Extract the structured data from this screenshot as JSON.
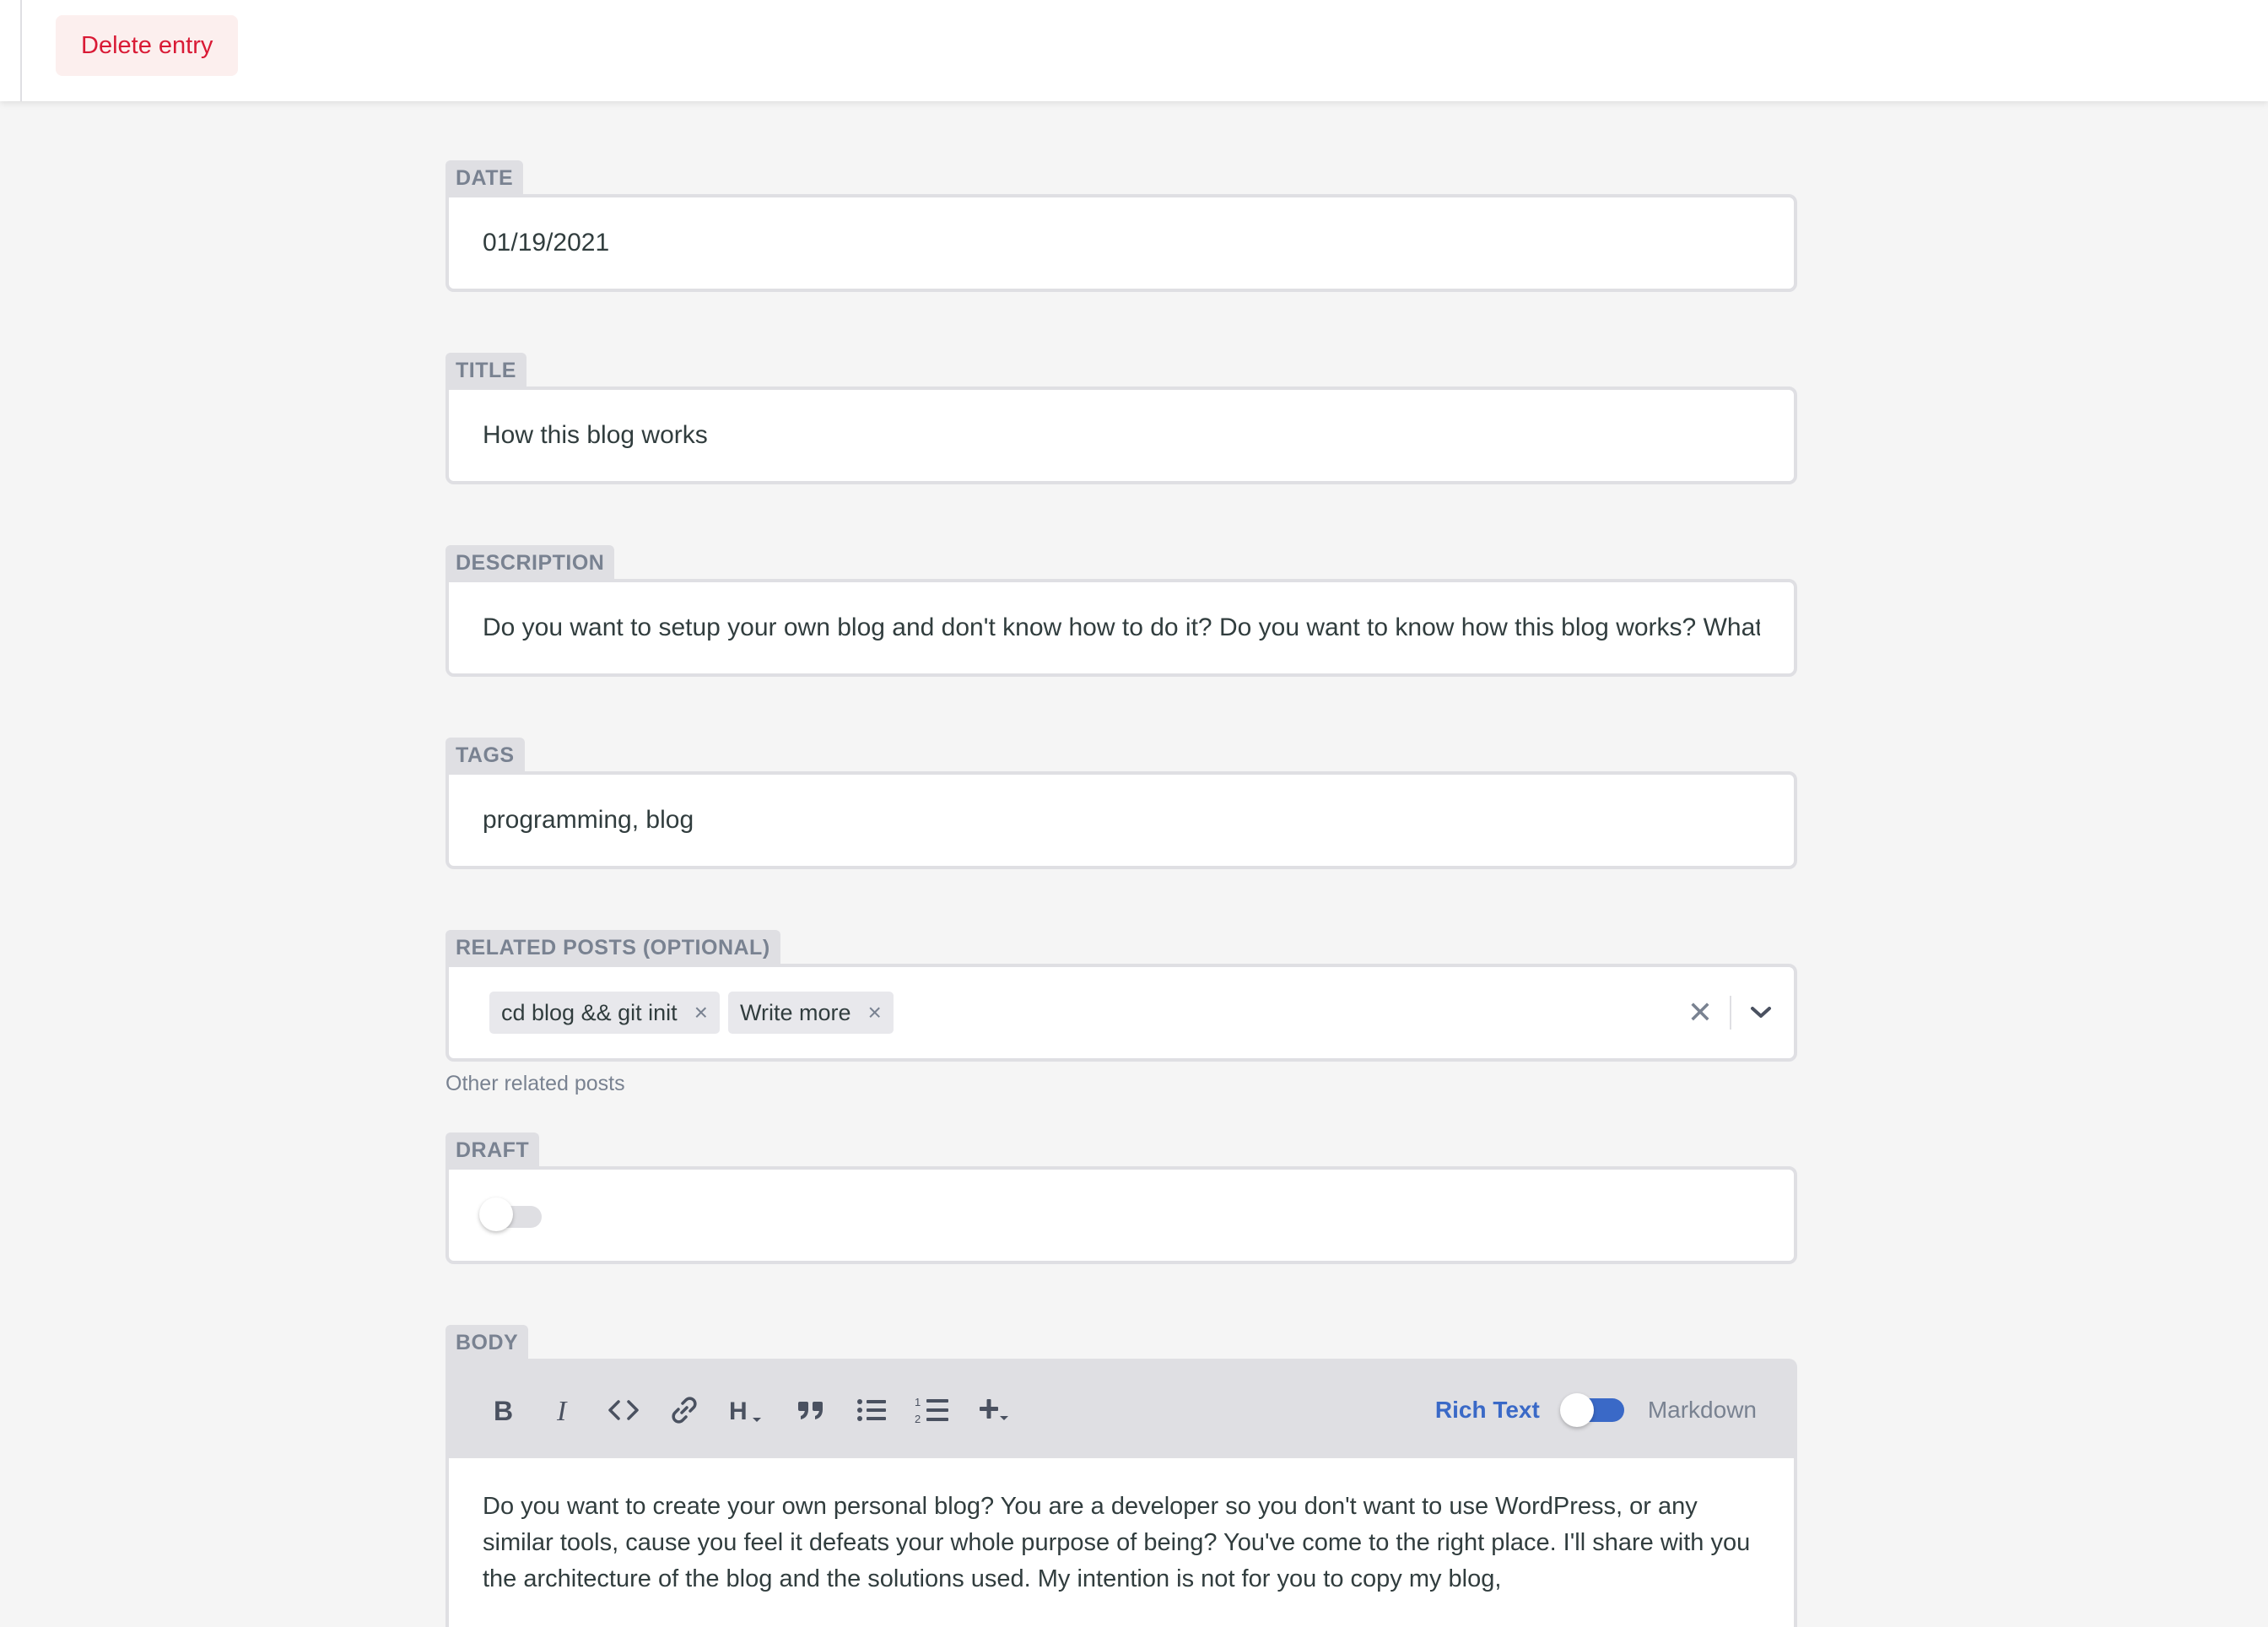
{
  "topbar": {
    "delete_label": "Delete entry"
  },
  "fields": {
    "date": {
      "label": "DATE",
      "value": "01/19/2021"
    },
    "title": {
      "label": "TITLE",
      "value": "How this blog works"
    },
    "description": {
      "label": "DESCRIPTION",
      "value": "Do you want to setup your own blog and don't know how to do it? Do you want to know how this blog works? What"
    },
    "tags": {
      "label": "TAGS",
      "value": "programming, blog"
    },
    "related": {
      "label": "RELATED POSTS (OPTIONAL)",
      "chips": [
        "cd blog && git init",
        "Write more"
      ],
      "chip_remove": "×",
      "clear": "✕",
      "hint": "Other related posts"
    },
    "draft": {
      "label": "DRAFT",
      "on": false
    },
    "body": {
      "label": "BODY",
      "toolbar": {
        "icons": [
          "bold-icon",
          "italic-icon",
          "code-icon",
          "link-icon",
          "heading-icon",
          "quote-icon",
          "bulleted-list-icon",
          "numbered-list-icon",
          "add-component-icon"
        ],
        "rich_text_label": "Rich Text",
        "markdown_label": "Markdown"
      },
      "text": "Do you want to create your own personal blog? You are a developer so you don't want to use WordPress, or any similar tools, cause you feel it defeats your whole purpose of being? You've come to the right place. I'll share with you the architecture of the blog and the solutions used. My intention is not for you to copy my blog,"
    }
  },
  "colors": {
    "accent": "#3a69c7",
    "danger": "#d91a35",
    "label_bg": "#dfdfe3"
  }
}
